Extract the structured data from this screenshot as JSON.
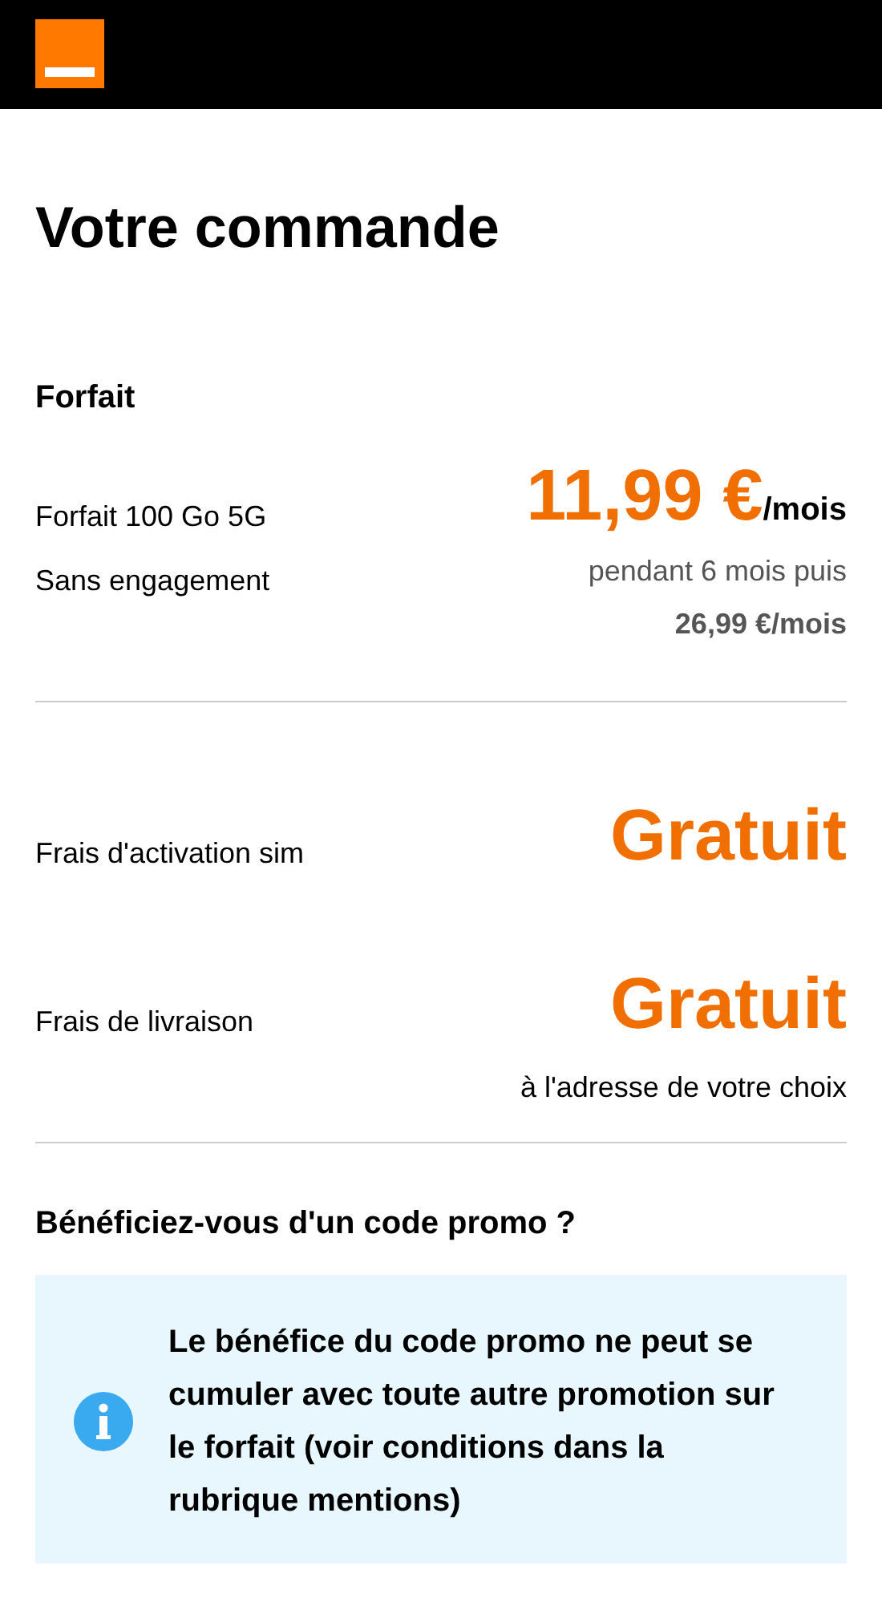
{
  "title": "Votre commande",
  "plan": {
    "heading": "Forfait",
    "name": "Forfait 100 Go 5G",
    "commitment": "Sans engagement",
    "price": "11,99 €",
    "price_unit": "/mois",
    "duration": "pendant 6 mois puis",
    "later_price": "26,99 €/mois"
  },
  "fees": [
    {
      "label": "Frais d'activation sim",
      "value": "Gratuit"
    },
    {
      "label": "Frais de livraison",
      "value": "Gratuit",
      "note": "à l'adresse de votre choix"
    }
  ],
  "promo": {
    "heading": "Bénéficiez-vous d'un code promo ?",
    "notice": "Le bénéfice du code promo ne peut se cumuler avec toute autre promotion sur le forfait (voir conditions dans la rubrique mentions)"
  }
}
